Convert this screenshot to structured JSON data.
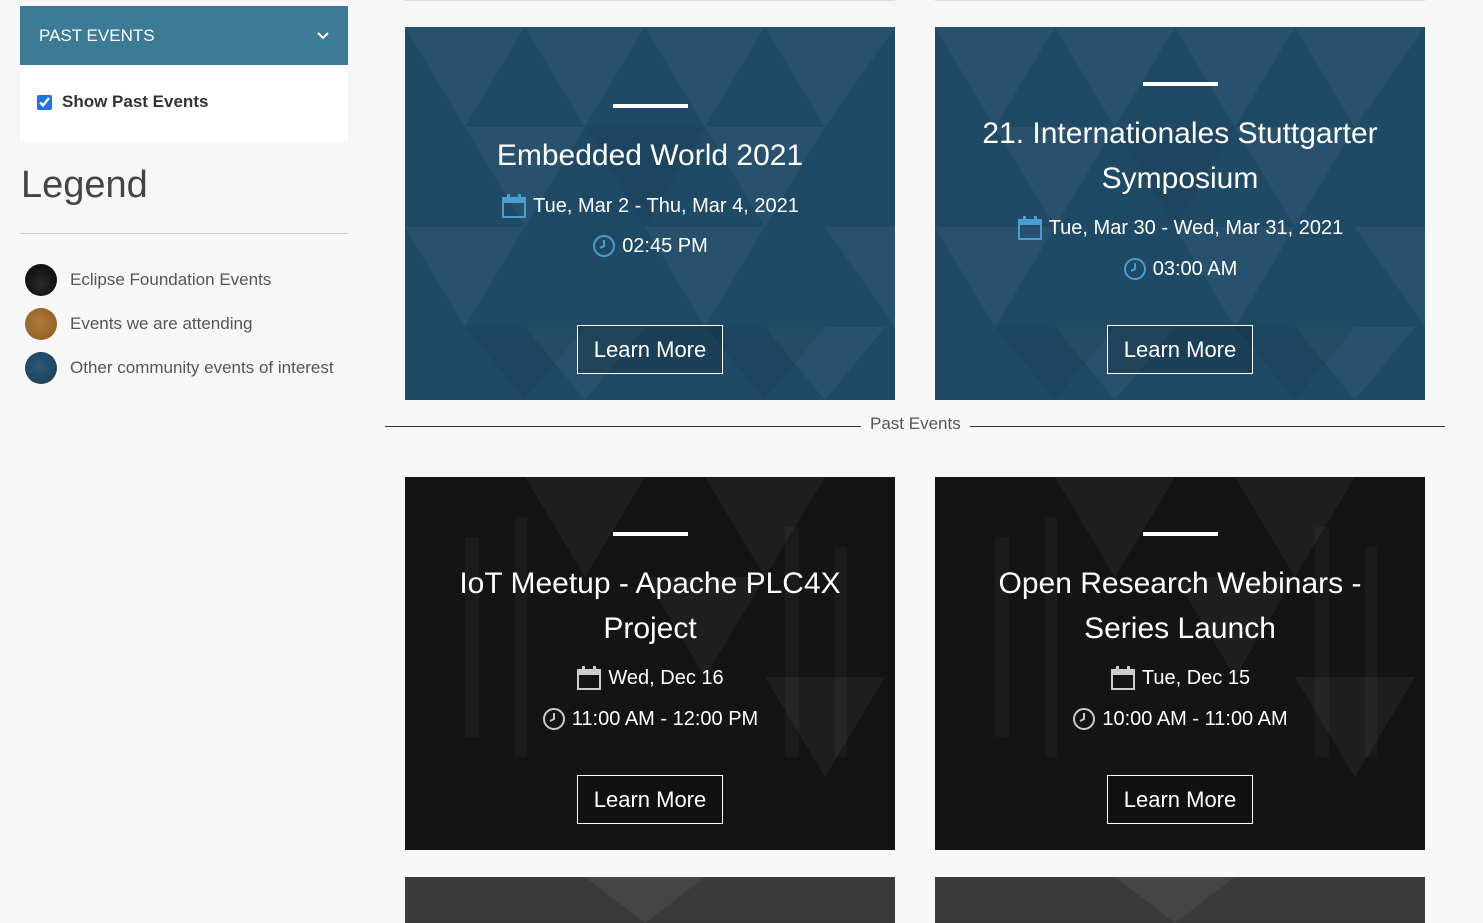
{
  "sidebar": {
    "filter_header": "PAST EVENTS",
    "show_past_label": "Show Past Events",
    "show_past_checked": true,
    "legend_title": "Legend",
    "legend_items": [
      {
        "label": "Eclipse Foundation Events",
        "color": "#111111"
      },
      {
        "label": "Events we are attending",
        "color": "#a06a2c"
      },
      {
        "label": "Other community events of interest",
        "color": "#1e4a63"
      }
    ]
  },
  "upcoming": [
    {
      "title": "Embedded World 2021",
      "date": "Tue, Mar 2 - Thu, Mar 4, 2021",
      "time": "02:45 PM",
      "button": "Learn More",
      "style": "blue"
    },
    {
      "title": "21. Internationales Stuttgarter Symposium",
      "date": "Tue, Mar 30 - Wed, Mar 31, 2021",
      "time": "03:00 AM",
      "button": "Learn More",
      "style": "blue"
    }
  ],
  "divider_label": "Past Events",
  "past": [
    {
      "title": "IoT Meetup - Apache PLC4X Project",
      "date": "Wed, Dec 16",
      "time": "11:00 AM - 12:00 PM",
      "button": "Learn More",
      "style": "dark"
    },
    {
      "title": "Open Research Webinars - Series Launch",
      "date": "Tue, Dec 15",
      "time": "10:00 AM - 11:00 AM",
      "button": "Learn More",
      "style": "dark"
    }
  ],
  "colors": {
    "accent": "#3d7a96",
    "card_blue": "#1f4a66",
    "card_dark": "#141414",
    "calendar_icon_blue": "#4a9fd0",
    "calendar_icon_dark": "#cccccc"
  }
}
